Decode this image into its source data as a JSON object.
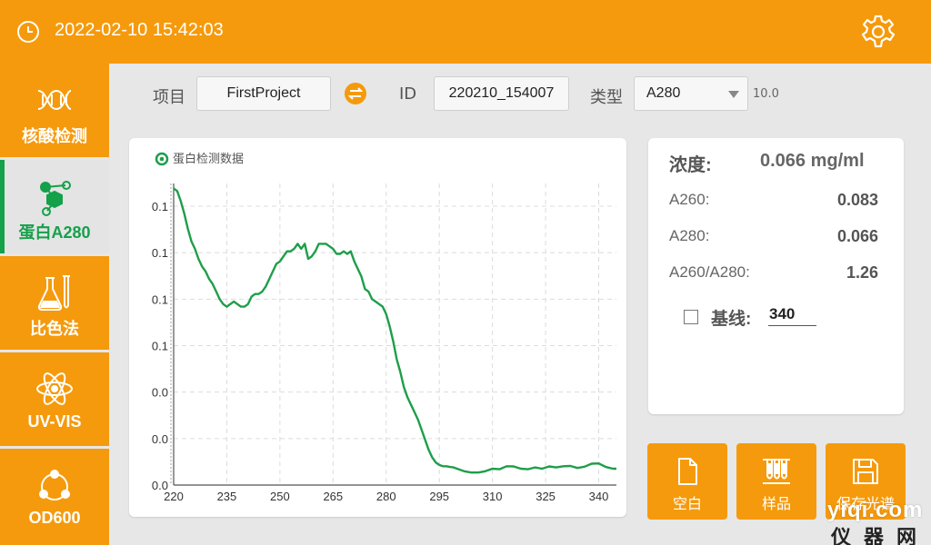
{
  "header": {
    "datetime": "2022-02-10 15:42:03"
  },
  "sidebar": {
    "items": [
      {
        "label": "核酸检测"
      },
      {
        "label": "蛋白A280"
      },
      {
        "label": "比色法"
      },
      {
        "label": "UV-VIS"
      },
      {
        "label": "OD600"
      }
    ]
  },
  "form": {
    "project_label": "项目",
    "project_value": "FirstProject",
    "id_label": "ID",
    "id_value": "220210_154007",
    "type_label": "类型",
    "type_value": "A280",
    "extra_value": "10.0"
  },
  "results": {
    "conc_label": "浓度:",
    "conc_value": "0.066 mg/ml",
    "rows": [
      {
        "label": "A260:",
        "value": "0.083"
      },
      {
        "label": "A280:",
        "value": "0.066"
      },
      {
        "label": "A260/A280:",
        "value": "1.26"
      }
    ],
    "baseline_label": "基线:",
    "baseline_value": "340"
  },
  "actions": {
    "blank": "空白",
    "sample": "样品",
    "save": "保存光谱"
  },
  "watermark": {
    "top": "yiqi.com",
    "bottom": "仪器网"
  },
  "colors": {
    "accent": "#f59a0c",
    "series": "#1e9e4a",
    "active": "#15a04a"
  },
  "chart_data": {
    "type": "line",
    "legend": "蛋白检测数据",
    "x_ticks": [
      220,
      235,
      250,
      265,
      280,
      295,
      310,
      325,
      340
    ],
    "y_tick_labels": [
      "0.0",
      "0.0",
      "0.0",
      "0.1",
      "0.1",
      "0.1",
      "0.1"
    ],
    "xlim": [
      220,
      345
    ],
    "ylim": [
      0,
      0.12
    ],
    "grid": true,
    "series": [
      {
        "x": [
          220,
          221,
          222,
          223,
          224,
          225,
          226,
          227,
          228,
          229,
          230,
          231,
          232,
          233,
          234,
          235,
          236,
          237,
          238,
          239,
          240,
          241,
          242,
          243,
          244,
          245,
          246,
          247,
          248,
          249,
          250,
          251,
          252,
          253,
          254,
          255,
          256,
          257,
          258,
          259,
          260,
          261,
          262,
          263,
          264,
          265,
          266,
          267,
          268,
          269,
          270,
          271,
          272,
          273,
          274,
          275,
          276,
          277,
          278,
          279,
          280,
          281,
          282,
          283,
          284,
          285,
          286,
          287,
          288,
          289,
          290,
          291,
          292,
          293,
          294,
          295,
          296,
          297,
          298,
          299,
          300,
          302,
          304,
          306,
          308,
          310,
          312,
          314,
          316,
          318,
          320,
          322,
          324,
          326,
          328,
          330,
          332,
          334,
          336,
          338,
          340,
          342,
          344,
          345
        ],
        "y": [
          0.118,
          0.117,
          0.113,
          0.108,
          0.102,
          0.097,
          0.094,
          0.09,
          0.087,
          0.085,
          0.082,
          0.08,
          0.077,
          0.074,
          0.072,
          0.071,
          0.072,
          0.073,
          0.072,
          0.071,
          0.071,
          0.072,
          0.075,
          0.076,
          0.076,
          0.077,
          0.079,
          0.082,
          0.085,
          0.088,
          0.089,
          0.091,
          0.093,
          0.093,
          0.094,
          0.096,
          0.094,
          0.096,
          0.09,
          0.091,
          0.093,
          0.096,
          0.096,
          0.096,
          0.095,
          0.094,
          0.092,
          0.092,
          0.093,
          0.092,
          0.093,
          0.089,
          0.086,
          0.083,
          0.078,
          0.077,
          0.074,
          0.073,
          0.072,
          0.071,
          0.068,
          0.063,
          0.057,
          0.05,
          0.045,
          0.039,
          0.035,
          0.032,
          0.029,
          0.026,
          0.022,
          0.018,
          0.014,
          0.011,
          0.009,
          0.008,
          0.0075,
          0.0075,
          0.0072,
          0.007,
          0.0065,
          0.0055,
          0.005,
          0.005,
          0.0055,
          0.0065,
          0.0063,
          0.0075,
          0.0074,
          0.0065,
          0.0063,
          0.007,
          0.0065,
          0.0074,
          0.007,
          0.0075,
          0.0076,
          0.0068,
          0.0073,
          0.0085,
          0.0086,
          0.0072,
          0.0065,
          0.0065
        ]
      }
    ]
  }
}
